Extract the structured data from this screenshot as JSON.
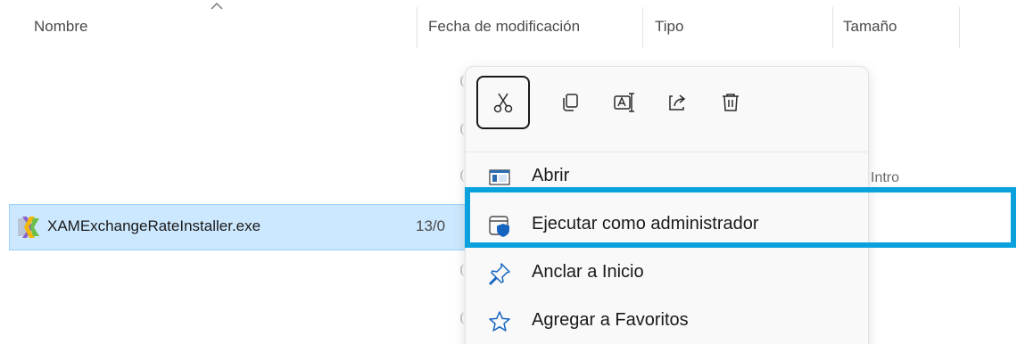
{
  "columns": {
    "name": "Nombre",
    "modified": "Fecha de modificación",
    "type": "Tipo",
    "size": "Tamaño"
  },
  "file": {
    "name": "XAMExchangeRateInstaller.exe",
    "date_partial": "13/0"
  },
  "toolbar": [
    {
      "icon": "scissors-icon",
      "action": "cut"
    },
    {
      "icon": "copy-icon",
      "action": "copy"
    },
    {
      "icon": "rename-icon",
      "action": "rename"
    },
    {
      "icon": "share-icon",
      "action": "share"
    },
    {
      "icon": "trash-icon",
      "action": "delete"
    }
  ],
  "menu": {
    "items": [
      {
        "label": "Abrir",
        "shortcut": "Intro",
        "icon": "window-icon"
      },
      {
        "label": "Ejecutar como administrador",
        "shortcut": "",
        "icon": "shield-icon"
      },
      {
        "label": "Anclar a Inicio",
        "shortcut": "",
        "icon": "pin-icon"
      },
      {
        "label": "Agregar a Favoritos",
        "shortcut": "",
        "icon": "star-icon"
      }
    ]
  },
  "colors": {
    "selection": "#cce8ff",
    "highlight_border": "#0aa1dd",
    "accent": "#1565c0"
  }
}
